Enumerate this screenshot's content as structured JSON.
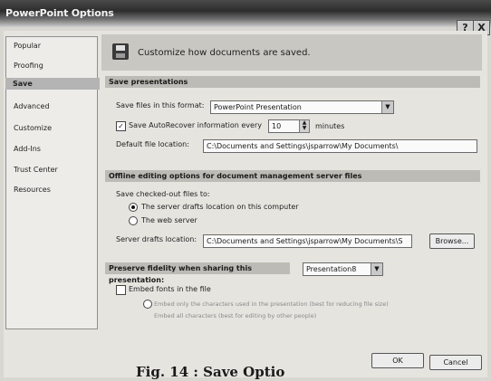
{
  "window": {
    "title": "PowerPoint Options",
    "help_label": "?",
    "close_label": "X"
  },
  "sidebar": {
    "items": [
      {
        "label": "Popular"
      },
      {
        "label": "Proofing"
      },
      {
        "label": "Save"
      },
      {
        "label": "Advanced"
      },
      {
        "label": "Customize"
      },
      {
        "label": "Add-Ins"
      },
      {
        "label": "Trust Center"
      },
      {
        "label": "Resources"
      }
    ],
    "selected": "Save"
  },
  "header": {
    "text": "Customize how documents are saved.",
    "icon": "floppy-disk-icon"
  },
  "save_presentations": {
    "section_title": "Save presentations",
    "format_label": "Save files in this format:",
    "format_value": "PowerPoint Presentation",
    "autorecover_label": "Save AutoRecover information every",
    "autorecover_checked": true,
    "autorecover_value": "10",
    "minutes_label": "minutes",
    "default_location_label": "Default file location:",
    "default_location_value": "C:\\Documents and Settings\\jsparrow\\My Documents\\"
  },
  "offline": {
    "section_title": "Offline editing options for document management server files",
    "checked_out_label": "Save checked-out files to:",
    "option_server_drafts": "The server drafts location on this computer",
    "option_web_server": "The web server",
    "selected_option": "server-drafts",
    "server_drafts_label": "Server drafts location:",
    "server_drafts_value": "C:\\Documents and Settings\\jsparrow\\My Documents\\S",
    "browse_label": "Browse..."
  },
  "fidelity": {
    "section_title": "Preserve fidelity when sharing this presentation:",
    "presentation_value": "Presentation8",
    "embed_fonts_label": "Embed fonts in the file",
    "embed_fonts_checked": false,
    "embed_used_label": "Embed only the characters used in the presentation (best for reducing file size)",
    "embed_all_label": "Embed all characters (best for editing by other people)"
  },
  "footer": {
    "ok_label": "OK",
    "cancel_label": "Cancel"
  },
  "caption": "Fig. 14 : Save Optio"
}
